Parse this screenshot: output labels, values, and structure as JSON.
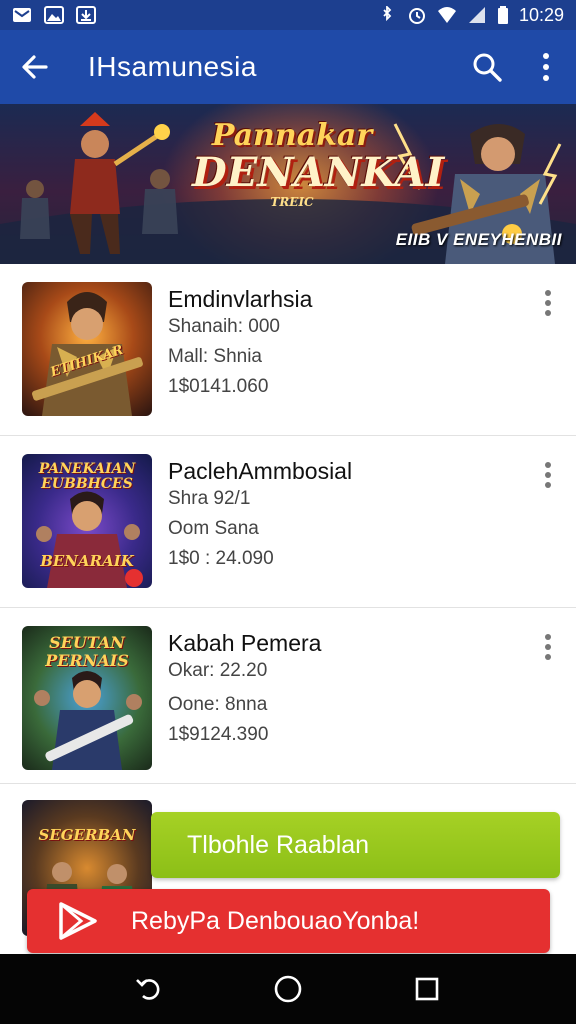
{
  "status_bar": {
    "time": "10:29",
    "left_icons": [
      "email-icon",
      "image-icon",
      "download-icon"
    ],
    "right_icons": [
      "bluetooth-icon",
      "alarm-icon",
      "wifi-icon",
      "signal-icon",
      "battery-icon"
    ]
  },
  "app_bar": {
    "title": "IHsamunesia",
    "back_icon": "arrow-left-icon",
    "search_icon": "search-icon",
    "overflow_icon": "more-vertical-icon",
    "color": "#1f4aa8"
  },
  "banner": {
    "title_line1": "Pannakar",
    "title_line2": "DENANKAI",
    "title_line3": "TREIC",
    "caption": "EIIB V ENEYHENBII"
  },
  "games": [
    {
      "title": "Emdinvlarhsia",
      "line1": "Shanaih: 000",
      "line2": "Mall: Shnia",
      "line3": "1$0141.060",
      "thumb_text": "ETIHIKAR"
    },
    {
      "title": "PaclehAmmbosial",
      "line1": "Shra 92/1",
      "line2": "Oom Sana",
      "line3": "1$0 : 24.090",
      "thumb_text_top": "PANEKAIAN EUBBHCES",
      "thumb_text_bottom": "BENARAIK"
    },
    {
      "title": "Kabah Pemera",
      "line1": "Okar: 22.20",
      "line2": "Oone: 8nna",
      "line3": "1$9124.390",
      "thumb_text": "SEUTAN PERNAIS"
    },
    {
      "title": "",
      "line1": "",
      "line2": "",
      "line3": "",
      "thumb_text": "SEGERBAN"
    }
  ],
  "green_button": {
    "label": "Tlbohle Raablan",
    "color": "#9bc91f"
  },
  "red_button": {
    "label": "RebyPa DenbouaoYonba!",
    "color": "#e53030",
    "icon": "play-promo-icon"
  },
  "nav_bar": {
    "back_icon": "nav-back-icon",
    "home_icon": "nav-home-icon",
    "recents_icon": "nav-recents-icon"
  }
}
